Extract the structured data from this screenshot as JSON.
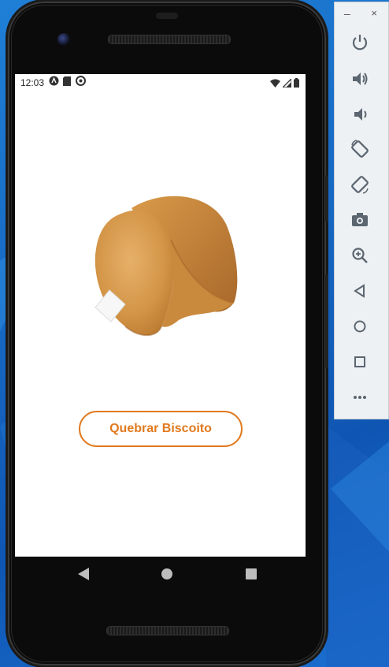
{
  "status_bar": {
    "time": "12:03"
  },
  "app": {
    "break_button_label": "Quebrar Biscoito",
    "accent_color": "#e07a1f",
    "cookie_image": "fortune-cookie-image"
  },
  "navigation": {
    "back": "back-icon",
    "home": "home-icon",
    "recents": "recents-icon"
  },
  "emulator_toolbar": {
    "minimize_label": "–",
    "close_label": "×",
    "tools": [
      "power-icon",
      "volume-up-icon",
      "volume-down-icon",
      "rotate-left-icon",
      "rotate-right-icon",
      "screenshot-icon",
      "zoom-icon",
      "back-icon",
      "home-icon",
      "overview-icon",
      "more-icon"
    ]
  }
}
